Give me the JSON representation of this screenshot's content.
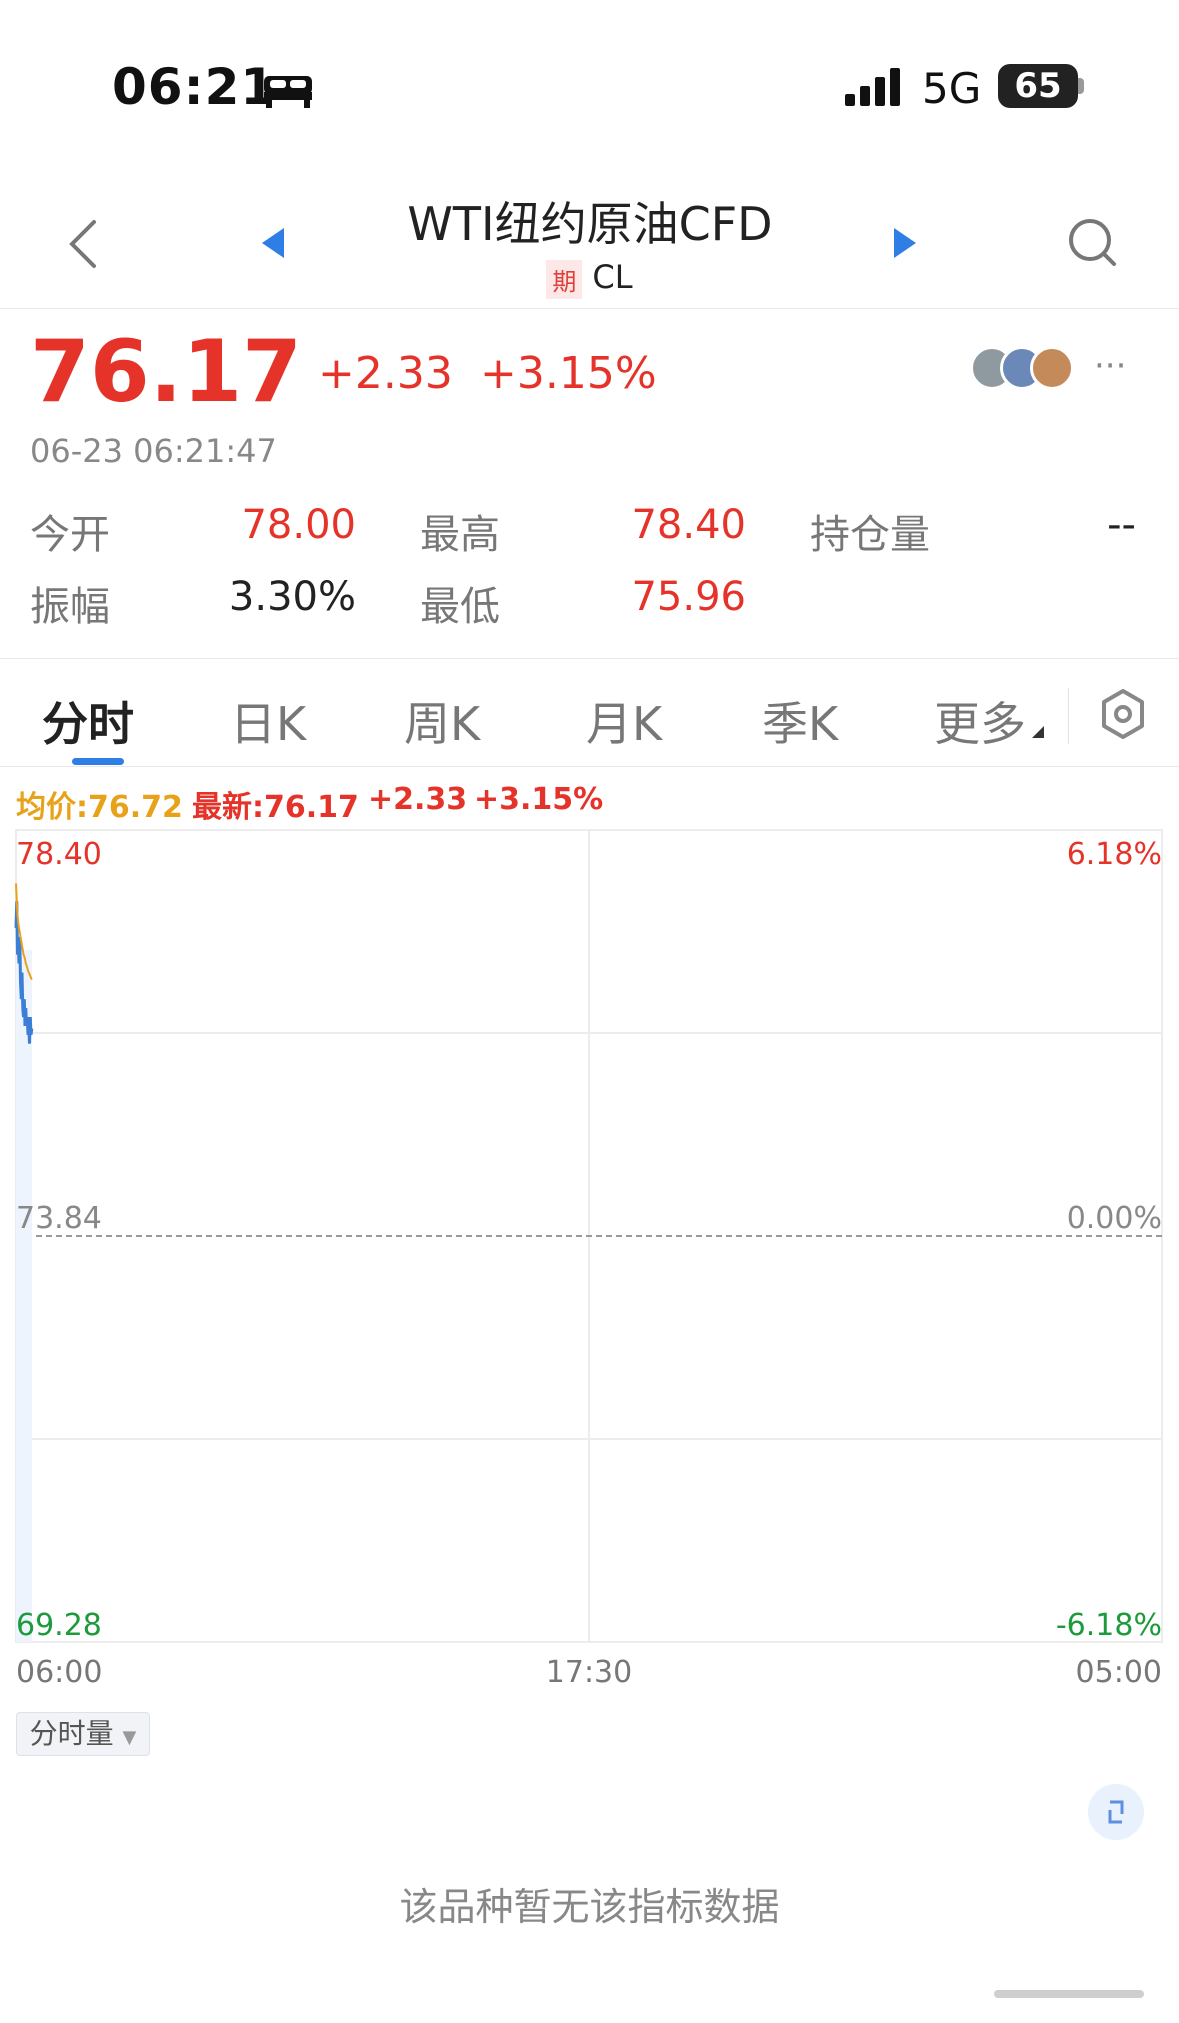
{
  "status_bar": {
    "time": "06:21",
    "network": "5G",
    "battery": "65"
  },
  "header": {
    "title": "WTI纽约原油CFD",
    "badge": "期",
    "symbol": "CL"
  },
  "quote": {
    "price": "76.17",
    "change": "+2.33",
    "change_pct": "+3.15%",
    "timestamp": "06-23 06:21:47",
    "more": "···"
  },
  "stats": [
    {
      "label": "今开",
      "value": "78.00"
    },
    {
      "label": "最高",
      "value": "78.40"
    },
    {
      "label": "持仓量",
      "value": "--"
    },
    {
      "label": "振幅",
      "value": "3.30%"
    },
    {
      "label": "最低",
      "value": "75.96"
    }
  ],
  "tabs": [
    {
      "label": "分时"
    },
    {
      "label": "日K"
    },
    {
      "label": "周K"
    },
    {
      "label": "月K"
    },
    {
      "label": "季K"
    },
    {
      "label": "更多"
    }
  ],
  "legend": {
    "avg": "均价:76.72",
    "latest": "最新:76.17",
    "change": "+2.33",
    "change_pct": "+3.15%"
  },
  "chart_data": {
    "type": "line",
    "y_labels_left": [
      "78.40",
      "73.84",
      "69.28"
    ],
    "y_labels_right": [
      "6.18%",
      "0.00%",
      "-6.18%"
    ],
    "x_labels": [
      "06:00",
      "17:30",
      "05:00"
    ],
    "ylim": [
      69.28,
      78.4
    ],
    "prev_close": 73.84,
    "series": [
      {
        "x": [
          "06:00",
          "06:01",
          "06:02",
          "06:03",
          "06:04",
          "06:05",
          "06:06",
          "06:07",
          "06:08",
          "06:09",
          "06:10",
          "06:11",
          "06:12",
          "06:13",
          "06:14",
          "06:15",
          "06:16",
          "06:17",
          "06:18",
          "06:19",
          "06:20",
          "06:21"
        ],
        "values": [
          77.3,
          77.6,
          77.0,
          77.1,
          76.9,
          77.2,
          76.7,
          76.5,
          76.8,
          76.4,
          76.3,
          76.5,
          76.2,
          76.4,
          76.2,
          76.3,
          76.1,
          76.2,
          76.0,
          76.3,
          76.1,
          76.17
        ],
        "color": "#3a7fd5"
      },
      {
        "x": [
          "06:00",
          "06:01",
          "06:02",
          "06:03",
          "06:04",
          "06:05",
          "06:06",
          "06:07",
          "06:08",
          "06:09",
          "06:10",
          "06:11",
          "06:12",
          "06:13",
          "06:14",
          "06:15",
          "06:16",
          "06:17",
          "06:18",
          "06:19",
          "06:20",
          "06:21"
        ],
        "values": [
          77.8,
          77.6,
          77.45,
          77.35,
          77.3,
          77.25,
          77.2,
          77.15,
          77.1,
          77.05,
          77.0,
          76.98,
          76.95,
          76.9,
          76.88,
          76.85,
          76.82,
          76.8,
          76.78,
          76.76,
          76.74,
          76.72
        ],
        "color": "#e8a21a"
      }
    ]
  },
  "volume_button": "分时量",
  "empty_message": "该品种暂无该指标数据",
  "colors": {
    "up": "#e5332a",
    "down": "#1c9a3c",
    "accent": "#2f7ee6",
    "avg": "#e8a21a"
  }
}
